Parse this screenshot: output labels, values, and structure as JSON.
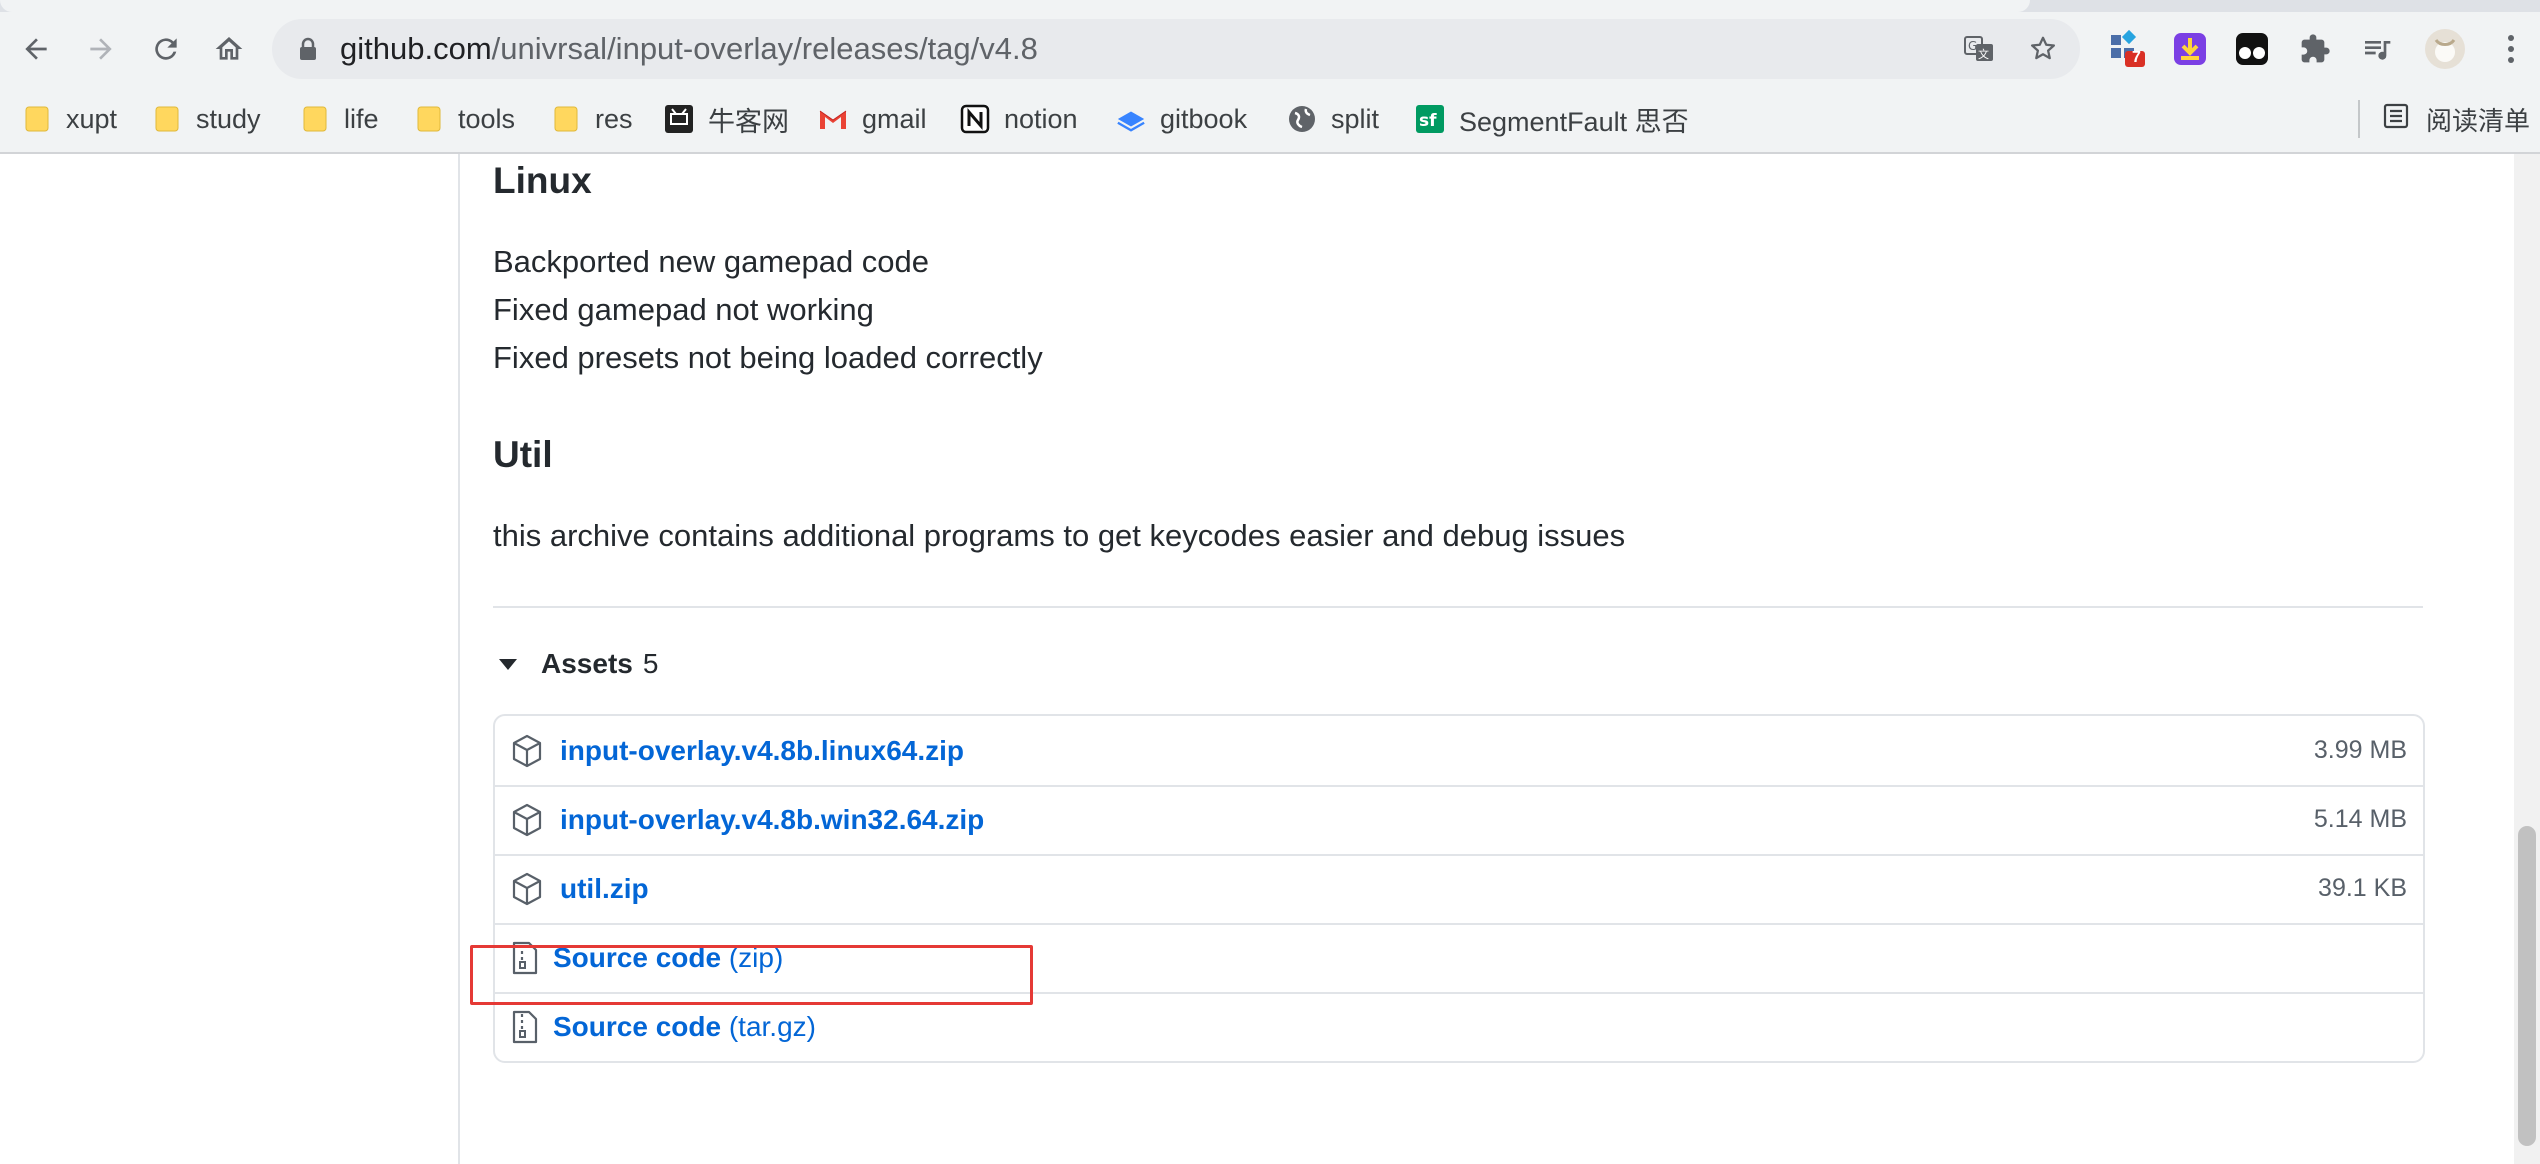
{
  "browser": {
    "url_host": "github.com",
    "url_path": "/univrsal/input-overlay/releases/tag/v4.8",
    "extension_badge": "7",
    "bookmarks": [
      {
        "label": "xupt",
        "icon": "folder-icon"
      },
      {
        "label": "study",
        "icon": "folder-icon"
      },
      {
        "label": "life",
        "icon": "folder-icon"
      },
      {
        "label": "tools",
        "icon": "folder-icon"
      },
      {
        "label": "res",
        "icon": "folder-icon"
      },
      {
        "label": "牛客网",
        "icon": "nowcoder-icon"
      },
      {
        "label": "gmail",
        "icon": "gmail-icon"
      },
      {
        "label": "notion",
        "icon": "notion-icon"
      },
      {
        "label": "gitbook",
        "icon": "gitbook-icon"
      },
      {
        "label": "split",
        "icon": "globe-icon"
      },
      {
        "label": "SegmentFault 思否",
        "icon": "segmentfault-icon"
      }
    ],
    "reading_list": "阅读清单"
  },
  "release": {
    "linux": {
      "heading": "Linux",
      "lines": [
        "Backported new gamepad code",
        "Fixed gamepad not working",
        "Fixed presets not being loaded correctly"
      ]
    },
    "util": {
      "heading": "Util",
      "text": "this archive contains additional programs to get keycodes easier and debug issues"
    },
    "assets": {
      "label": "Assets",
      "count": "5",
      "items": [
        {
          "name": "input-overlay.v4.8b.linux64.zip",
          "size": "3.99 MB"
        },
        {
          "name": "input-overlay.v4.8b.win32.64.zip",
          "size": "5.14 MB"
        },
        {
          "name": "util.zip",
          "size": "39.1 KB"
        },
        {
          "name": "Source code",
          "suffix": "(zip)"
        },
        {
          "name": "Source code",
          "suffix": "(tar.gz)"
        }
      ]
    }
  },
  "colors": {
    "link": "#0366d6",
    "highlight": "#e53935"
  }
}
